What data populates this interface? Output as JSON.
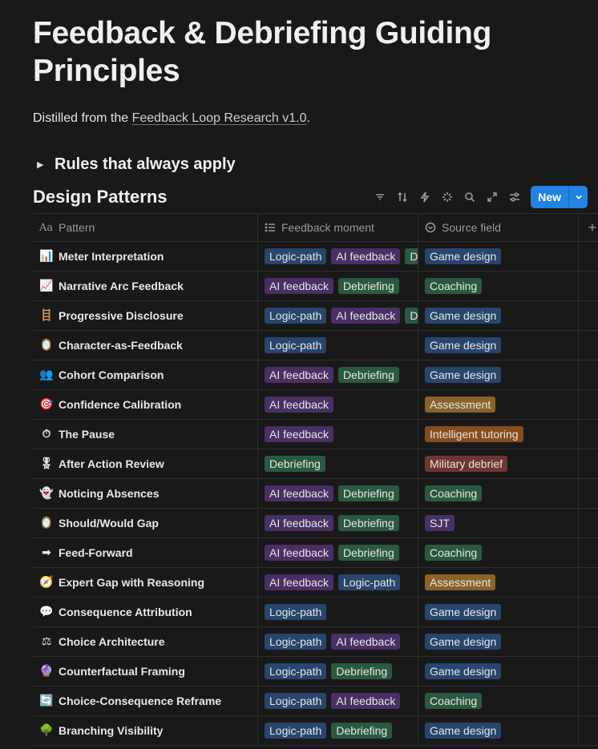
{
  "page": {
    "title": "Feedback & Debriefing Guiding Principles",
    "intro_prefix": "Distilled from the ",
    "intro_link": "Feedback Loop Research v1.0",
    "intro_suffix": ".",
    "toggle_label": "Rules that always apply"
  },
  "database": {
    "title": "Design Patterns",
    "new_button": "New",
    "columns": {
      "pattern": "Pattern",
      "moment": "Feedback moment",
      "source": "Source field"
    },
    "toolbar_icons": [
      "filter-icon",
      "sort-icon",
      "automation-icon",
      "ai-sparkle-icon",
      "search-icon",
      "expand-icon",
      "settings-icon"
    ],
    "tag_colors": {
      "Logic-path": "#28456c",
      "AI feedback": "#492f64",
      "Debriefing": "#2b593f",
      "Game design": "#28456c",
      "Coaching": "#2b593f",
      "Assessment": "#89632a",
      "Intelligent tutoring": "#854c1d",
      "Military debrief": "#6e3630",
      "SJT": "#492f64"
    },
    "rows": [
      {
        "emoji": "📊",
        "name": "Meter Interpretation",
        "moment": [
          "Logic-path",
          "AI feedback",
          "Debriefing"
        ],
        "source": [
          "Game design"
        ]
      },
      {
        "emoji": "📈",
        "name": "Narrative Arc Feedback",
        "moment": [
          "AI feedback",
          "Debriefing"
        ],
        "source": [
          "Coaching"
        ]
      },
      {
        "emoji": "🪜",
        "name": "Progressive Disclosure",
        "moment": [
          "Logic-path",
          "AI feedback",
          "Debriefing"
        ],
        "source": [
          "Game design"
        ]
      },
      {
        "emoji": "🪞",
        "name": "Character-as-Feedback",
        "moment": [
          "Logic-path"
        ],
        "source": [
          "Game design"
        ]
      },
      {
        "emoji": "👥",
        "name": "Cohort Comparison",
        "moment": [
          "AI feedback",
          "Debriefing"
        ],
        "source": [
          "Game design"
        ]
      },
      {
        "emoji": "🎯",
        "name": "Confidence Calibration",
        "moment": [
          "AI feedback"
        ],
        "source": [
          "Assessment"
        ]
      },
      {
        "emoji": "⏱",
        "name": "The Pause",
        "moment": [
          "AI feedback"
        ],
        "source": [
          "Intelligent tutoring"
        ]
      },
      {
        "emoji": "🎖",
        "name": "After Action Review",
        "moment": [
          "Debriefing"
        ],
        "source": [
          "Military debrief"
        ]
      },
      {
        "emoji": "👻",
        "name": "Noticing Absences",
        "moment": [
          "AI feedback",
          "Debriefing"
        ],
        "source": [
          "Coaching"
        ]
      },
      {
        "emoji": "🪞",
        "name": "Should/Would Gap",
        "moment": [
          "AI feedback",
          "Debriefing"
        ],
        "source": [
          "SJT"
        ]
      },
      {
        "emoji": "➡",
        "name": "Feed-Forward",
        "moment": [
          "AI feedback",
          "Debriefing"
        ],
        "source": [
          "Coaching"
        ]
      },
      {
        "emoji": "🧭",
        "name": "Expert Gap with Reasoning",
        "moment": [
          "AI feedback",
          "Logic-path"
        ],
        "source": [
          "Assessment"
        ]
      },
      {
        "emoji": "💬",
        "name": "Consequence Attribution",
        "moment": [
          "Logic-path"
        ],
        "source": [
          "Game design"
        ]
      },
      {
        "emoji": "⚖",
        "name": "Choice Architecture",
        "moment": [
          "Logic-path",
          "AI feedback"
        ],
        "source": [
          "Game design"
        ]
      },
      {
        "emoji": "🔮",
        "name": "Counterfactual Framing",
        "moment": [
          "Logic-path",
          "Debriefing"
        ],
        "source": [
          "Game design"
        ]
      },
      {
        "emoji": "🔄",
        "name": "Choice-Consequence Reframe",
        "moment": [
          "Logic-path",
          "AI feedback"
        ],
        "source": [
          "Coaching"
        ]
      },
      {
        "emoji": "🌳",
        "name": "Branching Visibility",
        "moment": [
          "Logic-path",
          "Debriefing"
        ],
        "source": [
          "Game design"
        ]
      }
    ]
  }
}
